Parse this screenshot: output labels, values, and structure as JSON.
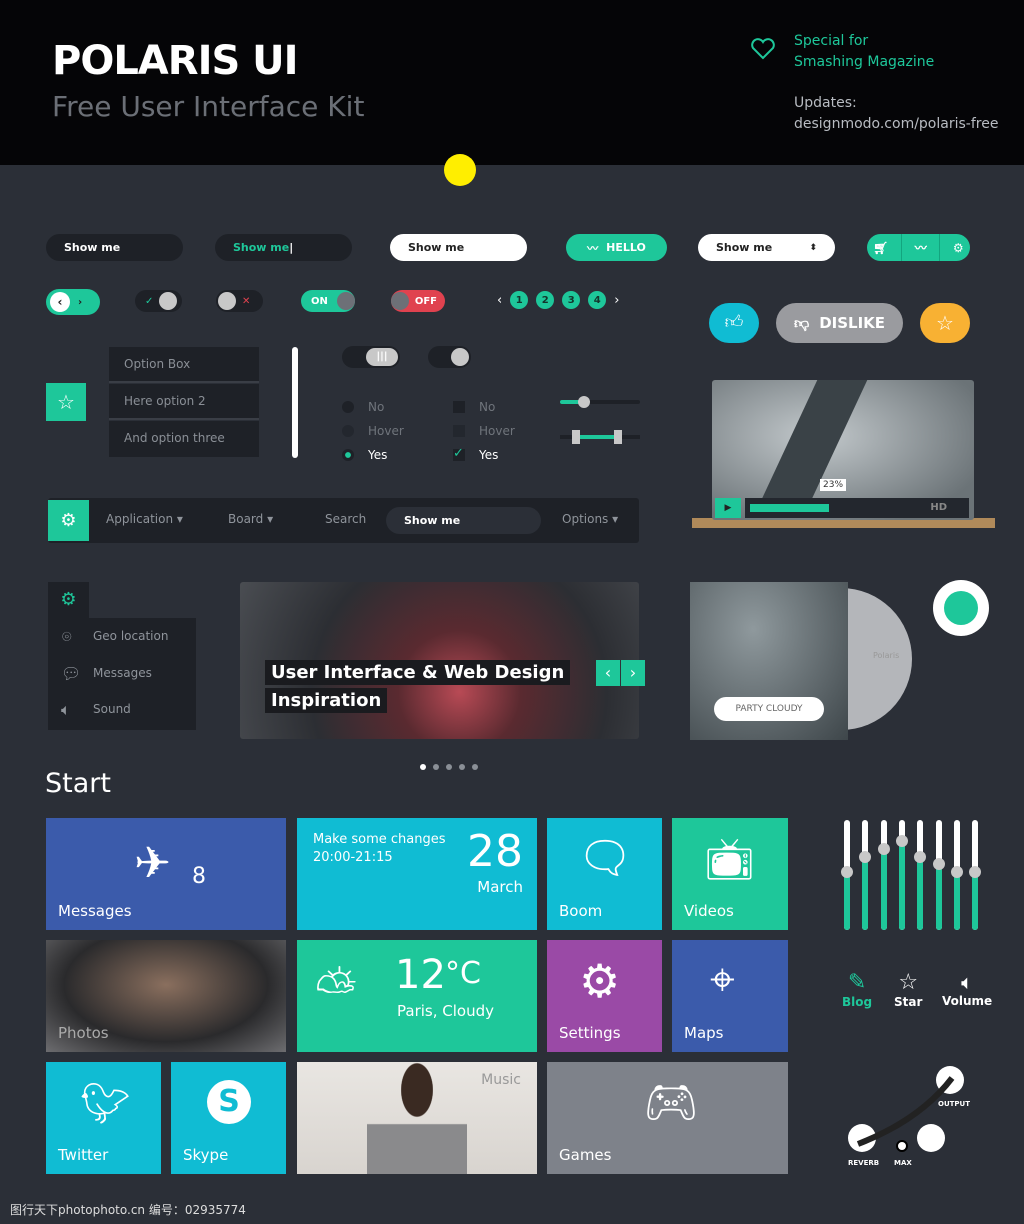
{
  "header": {
    "title": "POLARIS UI",
    "subtitle": "Free User Interface Kit",
    "special_line1": "Special for",
    "special_line2": "Smashing Magazine",
    "updates_label": "Updates:",
    "updates_url": "designmodo.com/polaris-free",
    "heart_icon": "heart-icon"
  },
  "inputs": {
    "dark": "Show me",
    "active": "Show me",
    "white": "Show me",
    "hello": "HELLO",
    "select": "Show me"
  },
  "toggles": {
    "on": "ON",
    "off": "OFF"
  },
  "pagination": [
    "1",
    "2",
    "3",
    "4"
  ],
  "reactions": {
    "dislike": "DISLIKE"
  },
  "dropdown": {
    "options": [
      "Option Box",
      "Here option 2",
      "And option three"
    ]
  },
  "radios": [
    "No",
    "Hover",
    "Yes"
  ],
  "checkboxes": [
    "No",
    "Hover",
    "Yes"
  ],
  "sliders": {
    "single": 0.3,
    "range": [
      0.2,
      0.72
    ]
  },
  "video": {
    "progress_label": "23%",
    "progress": 0.23,
    "quality": "HD"
  },
  "navbar": {
    "items": [
      "Application",
      "Board",
      "Search",
      "Options"
    ],
    "search_value": "Show me"
  },
  "sidemenu": {
    "items": [
      "Geo location",
      "Messages",
      "Sound"
    ]
  },
  "slider": {
    "caption_line1": "User Interface & Web Design",
    "caption_line2": "Inspiration",
    "active_dot": 0,
    "dots": 5
  },
  "album": {
    "button": "PARTY CLOUDY",
    "disc_label": "Polaris"
  },
  "start": {
    "title": "Start",
    "tiles": {
      "messages": "Messages",
      "messages_count": "8",
      "event_text": "Make some changes",
      "event_time": "20:00-21:15",
      "event_day": "28",
      "event_month": "March",
      "boom": "Boom",
      "videos": "Videos",
      "photos": "Photos",
      "weather_temp": "12",
      "weather_unit": "°C",
      "weather_place": "Paris, Cloudy",
      "settings": "Settings",
      "maps": "Maps",
      "twitter": "Twitter",
      "skype": "Skype",
      "music": "Music",
      "games": "Games"
    }
  },
  "equalizer": [
    0.53,
    0.66,
    0.74,
    0.81,
    0.66,
    0.6,
    0.53,
    0.53
  ],
  "icon_links": [
    "Blog",
    "Star",
    "Volume"
  ],
  "patch": {
    "reverb": "REVERB",
    "max": "MAX",
    "output": "OUTPUT"
  },
  "colors": {
    "accent": "#1ec79a",
    "background": "#2b2f37",
    "blue": "#3b5bab",
    "cyan": "#10bcd3",
    "purple": "#9a4aa6",
    "grey": "#7e828a",
    "orange": "#f8b133",
    "off": "#e0424f"
  },
  "watermark": "图行天下photophoto.cn  编号：02935774"
}
